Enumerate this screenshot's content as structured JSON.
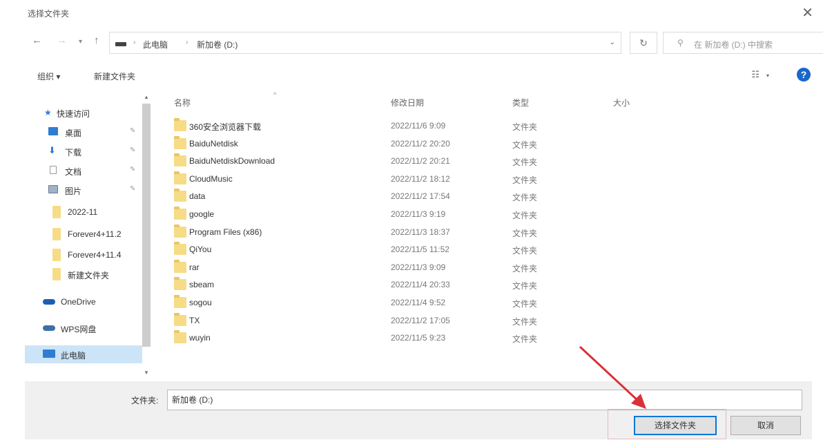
{
  "window": {
    "title": "选择文件夹",
    "close_symbol": "✕"
  },
  "nav": {
    "back_symbol": "←",
    "forward_symbol": "→",
    "recent_symbol": "▾",
    "up_symbol": "↑",
    "breadcrumbs": [
      "此电脑",
      "新加卷 (D:)"
    ],
    "breadcrumb_sep": "›",
    "address_dropdown_symbol": "⌄",
    "refresh_symbol": "↻",
    "search_placeholder": "在 新加卷 (D:) 中搜索"
  },
  "toolbar": {
    "organize": "组织 ▾",
    "new_folder": "新建文件夹",
    "view_symbol": "☷",
    "view_dropdown": "▾",
    "help_symbol": "?"
  },
  "sidebar": {
    "quick_access": "快速访问",
    "items": [
      {
        "label": "桌面",
        "icon": "desktop-icon",
        "pinned": true
      },
      {
        "label": "下载",
        "icon": "download-icon",
        "pinned": true
      },
      {
        "label": "文档",
        "icon": "document-icon",
        "pinned": true
      },
      {
        "label": "图片",
        "icon": "picture-icon",
        "pinned": true
      },
      {
        "label": "2022-11",
        "icon": "folder-icon",
        "pinned": false
      },
      {
        "label": "Forever4+11.2",
        "icon": "folder-icon",
        "pinned": false
      },
      {
        "label": "Forever4+11.4",
        "icon": "folder-icon",
        "pinned": false
      },
      {
        "label": "新建文件夹",
        "icon": "folder-icon",
        "pinned": false
      }
    ],
    "onedrive": "OneDrive",
    "wps": "WPS网盘",
    "this_pc": "此电脑",
    "pin_symbol": "✎"
  },
  "columns": {
    "name": "名称",
    "modified": "修改日期",
    "type": "类型",
    "size": "大小",
    "sort_symbol": "^"
  },
  "files": [
    {
      "name": "360安全浏览器下载",
      "date": "2022/11/6 9:09",
      "type": "文件夹"
    },
    {
      "name": "BaiduNetdisk",
      "date": "2022/11/2 20:20",
      "type": "文件夹"
    },
    {
      "name": "BaiduNetdiskDownload",
      "date": "2022/11/2 20:21",
      "type": "文件夹"
    },
    {
      "name": "CloudMusic",
      "date": "2022/11/2 18:12",
      "type": "文件夹"
    },
    {
      "name": "data",
      "date": "2022/11/2 17:54",
      "type": "文件夹"
    },
    {
      "name": "google",
      "date": "2022/11/3 9:19",
      "type": "文件夹"
    },
    {
      "name": "Program Files (x86)",
      "date": "2022/11/3 18:37",
      "type": "文件夹"
    },
    {
      "name": "QiYou",
      "date": "2022/11/5 11:52",
      "type": "文件夹"
    },
    {
      "name": "rar",
      "date": "2022/11/3 9:09",
      "type": "文件夹"
    },
    {
      "name": "sbeam",
      "date": "2022/11/4 20:33",
      "type": "文件夹"
    },
    {
      "name": "sogou",
      "date": "2022/11/4 9:52",
      "type": "文件夹"
    },
    {
      "name": "TX",
      "date": "2022/11/2 17:05",
      "type": "文件夹"
    },
    {
      "name": "wuyin",
      "date": "2022/11/5 9:23",
      "type": "文件夹"
    }
  ],
  "footer": {
    "folder_label": "文件夹:",
    "folder_value": "新加卷 (D:)",
    "select_button": "选择文件夹",
    "cancel_button": "取消"
  },
  "colors": {
    "accent": "#0078d7",
    "annotation_arrow": "#d9303a",
    "folder": "#f6dc86"
  }
}
